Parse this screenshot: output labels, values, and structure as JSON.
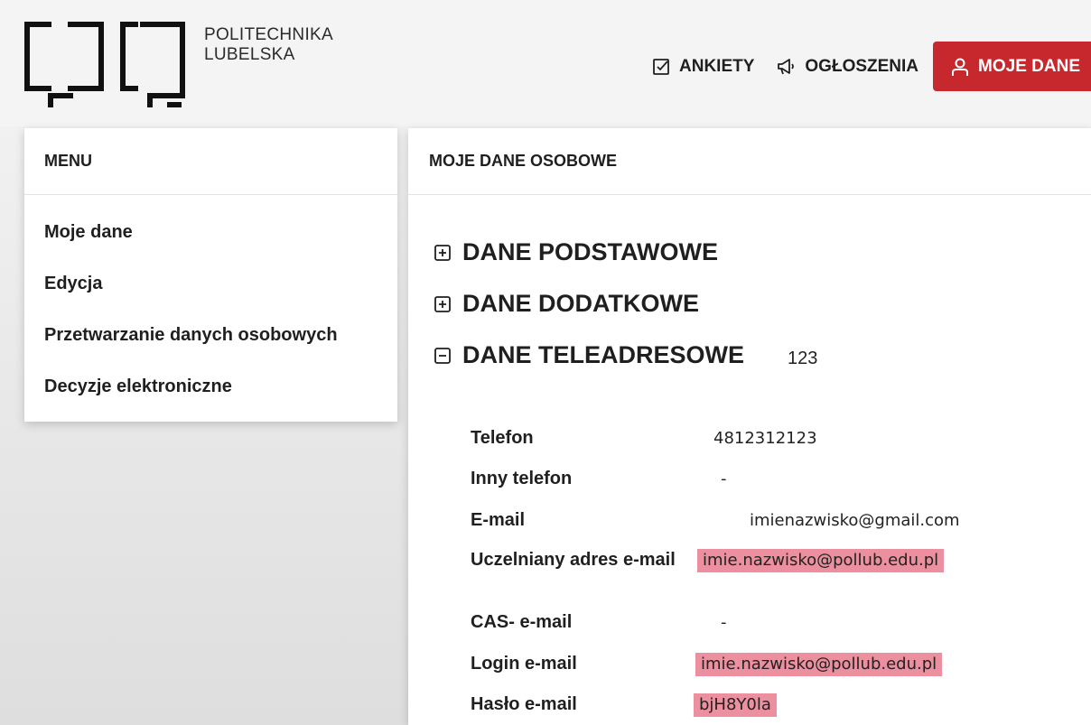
{
  "brand": {
    "line1": "POLITECHNIKA",
    "line2": "LUBELSKA"
  },
  "nav": [
    {
      "label": "ANKIETY",
      "icon": "checkbox-icon"
    },
    {
      "label": "OGŁOSZENIA",
      "icon": "megaphone-icon"
    },
    {
      "label": "MOJE DANE",
      "icon": "user-icon",
      "active": true
    }
  ],
  "sidebar": {
    "title": "MENU",
    "items": [
      {
        "label": "Moje dane"
      },
      {
        "label": "Edycja"
      },
      {
        "label": "Przetwarzanie danych osobowych"
      },
      {
        "label": "Decyzje elektroniczne"
      }
    ]
  },
  "main": {
    "title": "MOJE DANE OSOBOWE",
    "sections": [
      {
        "label": "DANE PODSTAWOWE",
        "state": "collapsed"
      },
      {
        "label": "DANE DODATKOWE",
        "state": "collapsed"
      },
      {
        "label": "DANE TELEADRESOWE",
        "state": "expanded",
        "extra": "123"
      }
    ],
    "fields": [
      {
        "label": "Telefon",
        "value": "4812312123"
      },
      {
        "label": "Inny telefon",
        "value": "-"
      },
      {
        "label": "E-mail",
        "value": "imienazwisko@gmail.com"
      },
      {
        "label": "Uczelniany adres e-mail",
        "value": "imie.nazwisko@pollub.edu.pl"
      },
      {
        "label": "CAS- e-mail",
        "value": "-"
      },
      {
        "label": "Login e-mail",
        "value": "imie.nazwisko@pollub.edu.pl"
      },
      {
        "label": "Hasło e-mail",
        "value": "bjH8Y0la"
      }
    ]
  },
  "colors": {
    "accent": "#c7282e",
    "highlight": "#ec8f9e"
  }
}
